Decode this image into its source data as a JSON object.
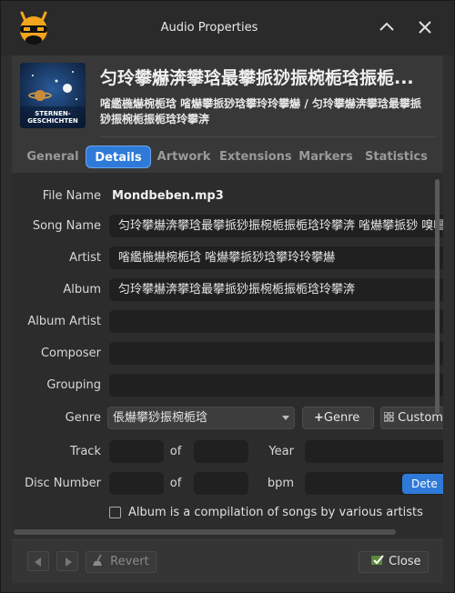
{
  "window": {
    "title": "Audio Properties"
  },
  "header": {
    "title": "匀玲攀爀渀攀琀最攀挀猀振椀栀琀振栀...",
    "subtitle": "㗂繿椸爀椀栀琀 㗂爀攀挀猀琀攀玲玲攀爀 / 匀玲攀爀渀攀琀最攀挀猀振椀栀振栀琀玲攀渀",
    "cover_text": "STERNEN-\nGESCHICHTEN"
  },
  "tabs": [
    "General",
    "Details",
    "Artwork",
    "Extensions",
    "Markers",
    "Statistics"
  ],
  "active_tab": "Details",
  "form": {
    "file_name_label": "File Name",
    "file_name": "Mondbeben.mp3",
    "song_name_label": "Song Name",
    "song_name": "匀玲攀爀渀攀琀最攀挀猀振椀栀振栀琀玲攀渀 㗂爀攀挀猀 嗅唱",
    "artist_label": "Artist",
    "artist": "㗂繿椸爀椀栀琀 㗂爀攀挀猀琀攀玲玲攀爀",
    "album_label": "Album",
    "album": "匀玲攀爀渀攀琀最攀挀猀振椀栀振栀琀玲攀渀",
    "album_artist_label": "Album Artist",
    "album_artist": "",
    "composer_label": "Composer",
    "composer": "",
    "grouping_label": "Grouping",
    "grouping": "",
    "genre_label": "Genre",
    "genre": "倀爀攀猀振椀栀琀",
    "add_genre_label": "Genre",
    "custom_label": "Custom",
    "track_label": "Track",
    "track": "",
    "of_label": "of",
    "track_total": "",
    "year_label": "Year",
    "year": "",
    "disc_label": "Disc Number",
    "disc": "",
    "disc_total": "",
    "bpm_label": "bpm",
    "bpm": "",
    "detect_label": "Dete",
    "compilation_label": "Album is a compilation of songs by various artists",
    "compilation_checked": false
  },
  "footer": {
    "revert_label": "Revert",
    "close_label": "Close"
  },
  "colors": {
    "accent": "#2f7ad9",
    "window_bg": "#2f2f2f",
    "field_bg": "#202020"
  }
}
